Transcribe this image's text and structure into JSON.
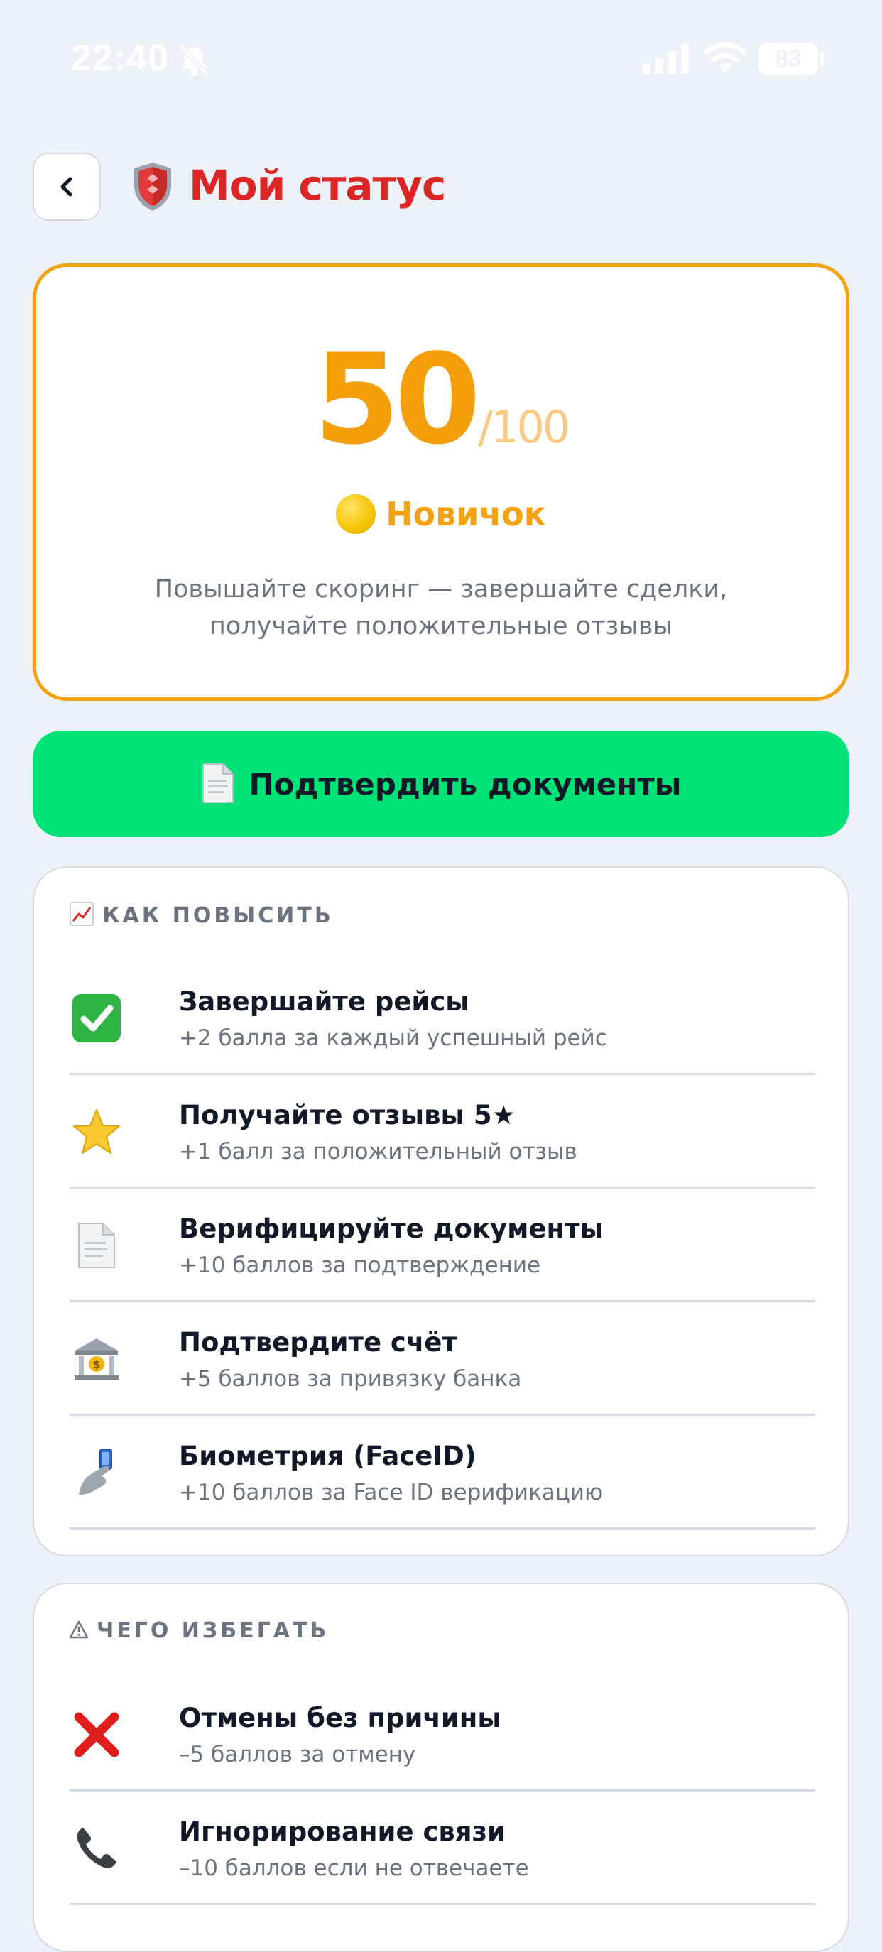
{
  "status_bar": {
    "time": "22:40",
    "battery": "83",
    "icons": [
      "bell-slash-icon",
      "signal-icon",
      "wifi-icon",
      "battery-icon"
    ]
  },
  "header": {
    "title": "Мой статус",
    "back_icon": "chevron-left-icon",
    "title_icon": "shield-icon"
  },
  "score": {
    "value": "50",
    "max": "/100",
    "fraction": 0.5,
    "level_icon": "yellow-circle-icon",
    "level": "Новичок",
    "description_line1": "Повышайте скоринг — завершайте сделки,",
    "description_line2": "получайте положительные отзывы"
  },
  "confirm_button": {
    "icon": "document-icon",
    "label": "Подтвердить документы"
  },
  "improve": {
    "icon": "chart-up-icon",
    "title": "КАК ПОВЫСИТЬ",
    "items": [
      {
        "icon": "check-mark-icon",
        "title": "Завершайте рейсы",
        "subtitle": "+2 балла за каждый успешный рейс"
      },
      {
        "icon": "star-icon",
        "title": "Получайте отзывы 5★",
        "subtitle": "+1 балл за положительный отзыв"
      },
      {
        "icon": "document-icon",
        "title": "Верифицируйте документы",
        "subtitle": "+10 баллов за подтверждение"
      },
      {
        "icon": "bank-icon",
        "title": "Подтвердите счёт",
        "subtitle": "+5 баллов за привязку банка"
      },
      {
        "icon": "phone-in-hand-icon",
        "title": "Биометрия (FaceID)",
        "subtitle": "+10 баллов за Face ID верификацию"
      }
    ]
  },
  "avoid": {
    "icon": "warning-icon",
    "title": "ЧЕГО ИЗБЕГАТЬ",
    "items": [
      {
        "icon": "cross-mark-icon",
        "title": "Отмены без причины",
        "subtitle": "–5 баллов за отмену"
      },
      {
        "icon": "phone-icon",
        "title": "Игнорирование связи",
        "subtitle": "–10 баллов если не отвечаете"
      }
    ]
  },
  "colors": {
    "title_red": "#dc2626",
    "score_orange": "#f59e0b",
    "card_border": "#f5a212",
    "button_green": "#00e277",
    "background": "#eef1f7"
  }
}
